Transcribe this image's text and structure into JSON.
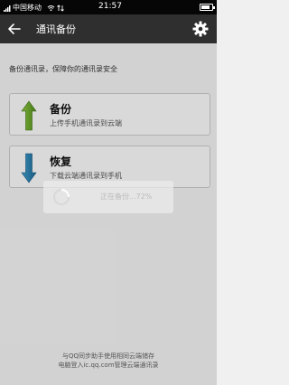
{
  "status_bar": {
    "carrier": "中国移动",
    "time": "21:57"
  },
  "header": {
    "title": "通讯备份"
  },
  "main": {
    "description": "备份通讯录，保障你的通讯录安全",
    "backup": {
      "title": "备份",
      "subtitle": "上传手机通讯录到云端"
    },
    "restore": {
      "title": "恢复",
      "subtitle": "下载云端通讯录到手机"
    }
  },
  "progress": {
    "text": "正在备份...72%",
    "percent": 72
  },
  "footer": {
    "line1": "与QQ同步助手使用相同云端储存",
    "line2": "电脑登入ic.qq.com管理云端通讯录"
  },
  "colors": {
    "action_bar": "#2f2f2f",
    "backup_arrow": "#6aa82a",
    "restore_arrow": "#2a7fae"
  }
}
